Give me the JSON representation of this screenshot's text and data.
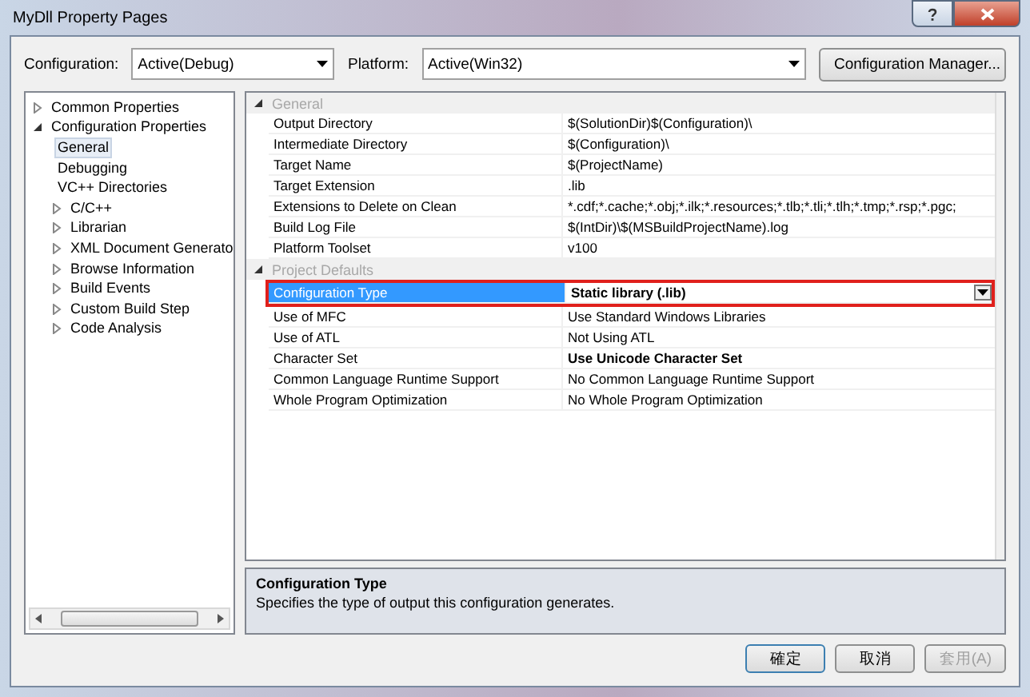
{
  "window": {
    "title": "MyDll Property Pages"
  },
  "toolbar": {
    "configuration_label": "Configuration:",
    "configuration_value": "Active(Debug)",
    "platform_label": "Platform:",
    "platform_value": "Active(Win32)",
    "manager_button": "Configuration Manager..."
  },
  "tree": [
    {
      "kind": "folder",
      "label": "Common Properties",
      "expanded": false,
      "selected": false
    },
    {
      "kind": "folder",
      "label": "Configuration Properties",
      "expanded": true,
      "selected": false,
      "children": [
        {
          "kind": "page",
          "label": "General",
          "selected": true
        },
        {
          "kind": "page",
          "label": "Debugging",
          "selected": false
        },
        {
          "kind": "page",
          "label": "VC++ Directories",
          "selected": false
        },
        {
          "kind": "folder",
          "label": "C/C++",
          "expanded": false,
          "selected": false
        },
        {
          "kind": "folder",
          "label": "Librarian",
          "expanded": false,
          "selected": false
        },
        {
          "kind": "folder",
          "label": "XML Document Generato",
          "expanded": false,
          "selected": false
        },
        {
          "kind": "folder",
          "label": "Browse Information",
          "expanded": false,
          "selected": false
        },
        {
          "kind": "folder",
          "label": "Build Events",
          "expanded": false,
          "selected": false
        },
        {
          "kind": "folder",
          "label": "Custom Build Step",
          "expanded": false,
          "selected": false
        },
        {
          "kind": "folder",
          "label": "Code Analysis",
          "expanded": false,
          "selected": false
        }
      ]
    }
  ],
  "grid": [
    {
      "category": "General",
      "expanded": true,
      "rows": [
        {
          "name": "Output Directory",
          "value": "$(SolutionDir)$(Configuration)\\",
          "bold": false,
          "selected": false,
          "highlighted": false
        },
        {
          "name": "Intermediate Directory",
          "value": "$(Configuration)\\",
          "bold": false,
          "selected": false,
          "highlighted": false
        },
        {
          "name": "Target Name",
          "value": "$(ProjectName)",
          "bold": false,
          "selected": false,
          "highlighted": false
        },
        {
          "name": "Target Extension",
          "value": ".lib",
          "bold": false,
          "selected": false,
          "highlighted": false
        },
        {
          "name": "Extensions to Delete on Clean",
          "value": "*.cdf;*.cache;*.obj;*.ilk;*.resources;*.tlb;*.tli;*.tlh;*.tmp;*.rsp;*.pgc;",
          "bold": false,
          "selected": false,
          "highlighted": false
        },
        {
          "name": "Build Log File",
          "value": "$(IntDir)\\$(MSBuildProjectName).log",
          "bold": false,
          "selected": false,
          "highlighted": false
        },
        {
          "name": "Platform Toolset",
          "value": "v100",
          "bold": false,
          "selected": false,
          "highlighted": false
        }
      ]
    },
    {
      "category": "Project Defaults",
      "expanded": true,
      "rows": [
        {
          "name": "Configuration Type",
          "value": "Static library (.lib)",
          "bold": true,
          "selected": true,
          "highlighted": true
        },
        {
          "name": "Use of MFC",
          "value": "Use Standard Windows Libraries",
          "bold": false,
          "selected": false,
          "highlighted": false
        },
        {
          "name": "Use of ATL",
          "value": "Not Using ATL",
          "bold": false,
          "selected": false,
          "highlighted": false
        },
        {
          "name": "Character Set",
          "value": "Use Unicode Character Set",
          "bold": true,
          "selected": false,
          "highlighted": false
        },
        {
          "name": "Common Language Runtime Support",
          "value": "No Common Language Runtime Support",
          "bold": false,
          "selected": false,
          "highlighted": false
        },
        {
          "name": "Whole Program Optimization",
          "value": "No Whole Program Optimization",
          "bold": false,
          "selected": false,
          "highlighted": false
        }
      ]
    }
  ],
  "description": {
    "title": "Configuration Type",
    "text": "Specifies the type of output this configuration generates."
  },
  "buttons": [
    {
      "label": "確定",
      "disabled": false,
      "default": true
    },
    {
      "label": "取消",
      "disabled": false,
      "default": false
    },
    {
      "label": "套用(A)",
      "disabled": true,
      "default": false
    }
  ]
}
